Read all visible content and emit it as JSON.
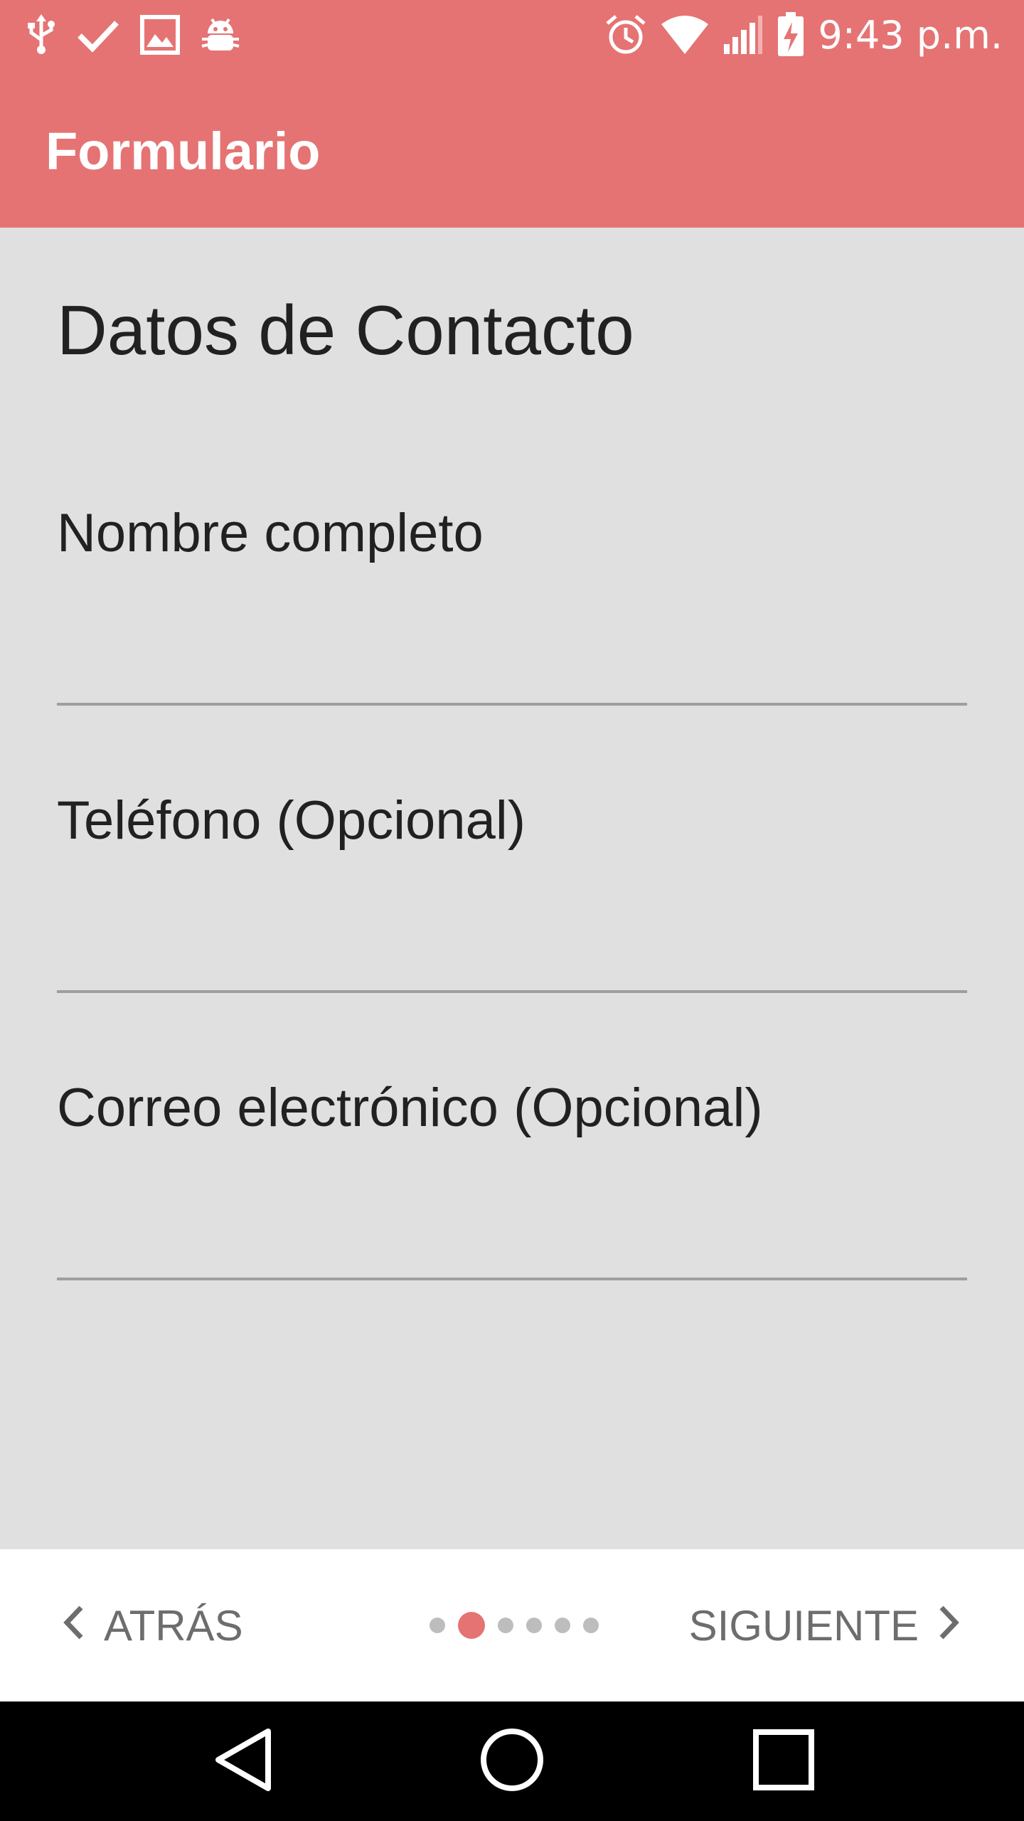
{
  "status_bar": {
    "left_icons": [
      "usb-icon",
      "check-icon",
      "image-icon",
      "android-debug-icon"
    ],
    "right_icons": [
      "alarm-icon",
      "wifi-icon",
      "signal-icon",
      "battery-charging-icon"
    ],
    "time": "9:43 p.m."
  },
  "app_bar": {
    "title": "Formulario",
    "background_color": "#e57373"
  },
  "form": {
    "section_title": "Datos de Contacto",
    "fields": [
      {
        "label": "Nombre completo",
        "value": ""
      },
      {
        "label": "Teléfono (Opcional)",
        "value": ""
      },
      {
        "label": "Correo electrónico (Opcional)",
        "value": ""
      }
    ]
  },
  "bottom_nav": {
    "back_label": "ATRÁS",
    "next_label": "SIGUIENTE",
    "page_count": 6,
    "current_page": 2,
    "back_icon": "chevron-left-icon",
    "next_icon": "chevron-right-icon"
  },
  "system_nav": {
    "buttons": [
      "back-triangle-icon",
      "home-circle-icon",
      "recents-square-icon"
    ]
  }
}
